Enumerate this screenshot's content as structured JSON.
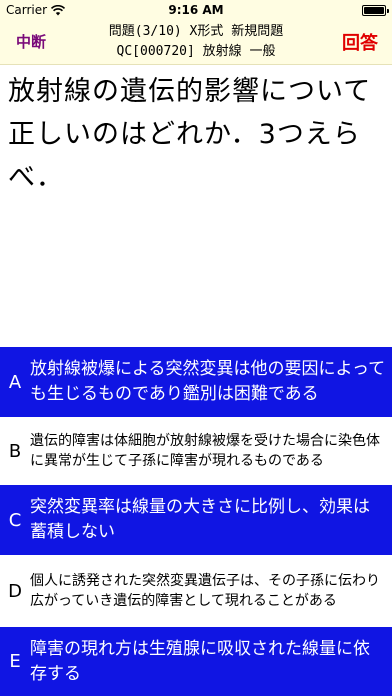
{
  "status_bar": {
    "carrier": "Carrier",
    "time": "9:16 AM",
    "battery_level": 1.0
  },
  "header": {
    "suspend_label": "中断",
    "answer_label": "回答",
    "line1": "問題(3/10) X形式 新規問題",
    "line2": "QC[000720] 放射線 一般"
  },
  "question": {
    "text": "放射線の遺伝的影響について正しいのはどれか．3つえらべ．"
  },
  "choices": [
    {
      "letter": "A",
      "text": "放射線被爆による突然変異は他の要因によっても生じるものであり鑑別は困難である"
    },
    {
      "letter": "B",
      "text": "遺伝的障害は体細胞が放射線被爆を受けた場合に染色体に異常が生じて子孫に障害が現れるものである"
    },
    {
      "letter": "C",
      "text": "突然変異率は線量の大きさに比例し、効果は蓄積しない"
    },
    {
      "letter": "D",
      "text": "個人に誘発された突然変異遺伝子は、その子孫に伝わり広がっていき遺伝的障害として現れることがある"
    },
    {
      "letter": "E",
      "text": "障害の現れ方は生殖腺に吸収された線量に依存する"
    }
  ],
  "colors": {
    "header_bg": "#fffde2",
    "choice_dark_bg": "#1015e3",
    "suspend": "#7a0a7a",
    "answer": "#e00000"
  }
}
